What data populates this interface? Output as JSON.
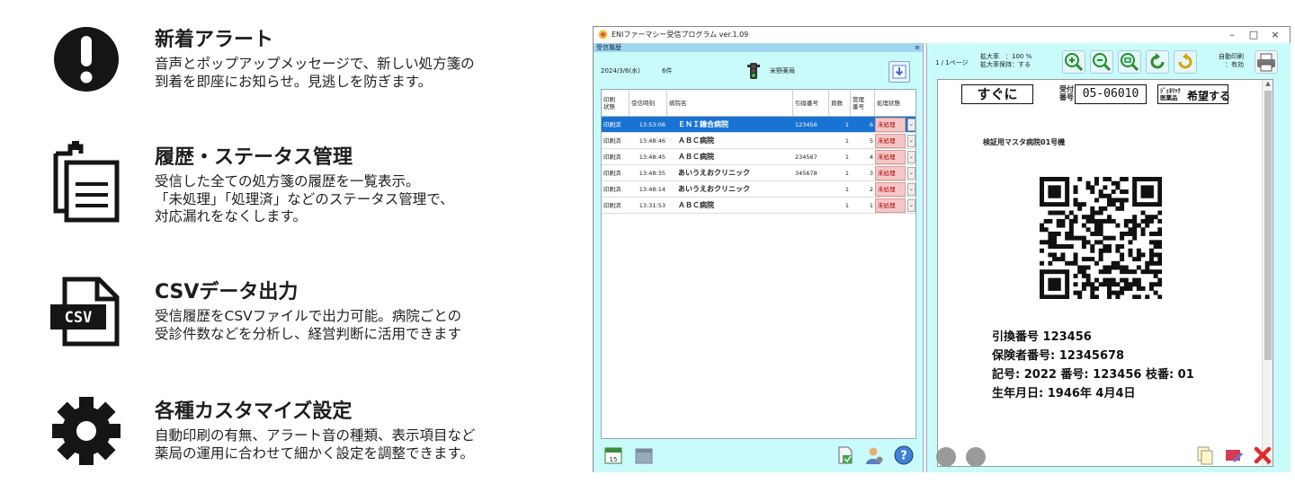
{
  "features": [
    {
      "icon": "alert-icon",
      "title": "新着アラート",
      "description": "音声とポップアップメッセージで、新しい処方箋の\n到着を即座にお知らせ。見逃しを防ぎます。"
    },
    {
      "icon": "clipboard-icon",
      "title": "履歴・ステータス管理",
      "description": "受信した全ての処方箋の履歴を一覧表示。\n「未処理」「処理済」などのステータス管理で、\n対応漏れをなくします。"
    },
    {
      "icon": "csv-file-icon",
      "title": "CSVデータ出力",
      "description": "受信履歴をCSVファイルで出力可能。病院ごとの\n受診件数などを分析し、経営判断に活用できます"
    },
    {
      "icon": "gear-icon",
      "title": "各種カスタマイズ設定",
      "description": "自動印刷の有無、アラート音の種類、表示項目など\n薬局の運用に合わせて細かく設定を調整できます。"
    }
  ],
  "csv_icon_label": "CSV",
  "window": {
    "title": "ENIファーマシー受信プログラム ver.1.09",
    "minimize": "–",
    "maximize": "□",
    "close": "×"
  },
  "left_pane": {
    "title": "受信履歴",
    "pin": "≡",
    "date": "2024/3/6(水)",
    "count": "6件",
    "pharmacy": "米野薬局",
    "columns": [
      "印刷\n状態",
      "受信時刻",
      "病院名",
      "引換番号",
      "頁数",
      "管理\n番号",
      "処理状態"
    ],
    "rows": [
      {
        "print": "印刷済",
        "time": "13:53:06",
        "hospital": "ＥＮＩ鐘合病院",
        "ticket": "123456",
        "pages": "1",
        "mgmt": "6",
        "status": "未処理",
        "selected": true
      },
      {
        "print": "印刷済",
        "time": "13:48:46",
        "hospital": "ＡＢＣ病院",
        "ticket": "",
        "pages": "1",
        "mgmt": "5",
        "status": "未処理",
        "selected": false
      },
      {
        "print": "印刷済",
        "time": "13:48:45",
        "hospital": "ＡＢＣ病院",
        "ticket": "234567",
        "pages": "1",
        "mgmt": "4",
        "status": "未処理",
        "selected": false
      },
      {
        "print": "印刷済",
        "time": "13:48:35",
        "hospital": "あいうえおクリニック",
        "ticket": "345678",
        "pages": "1",
        "mgmt": "3",
        "status": "未処理",
        "selected": false
      },
      {
        "print": "印刷済",
        "time": "13:48:14",
        "hospital": "あいうえおクリニック",
        "ticket": "",
        "pages": "1",
        "mgmt": "2",
        "status": "未処理",
        "selected": false
      },
      {
        "print": "印刷済",
        "time": "13:31:53",
        "hospital": "ＡＢＣ病院",
        "ticket": "",
        "pages": "1",
        "mgmt": "1",
        "status": "未処理",
        "selected": false
      }
    ],
    "calendar_label": "15"
  },
  "right_pane": {
    "page_info": "1 / 1ページ",
    "zoom_info": "拡大率　：100 %\n拡大率保持：する",
    "auto_print": "自動印刷\n：有効",
    "preview": {
      "sugu": "すぐに",
      "uketsuke_label": "受付\n番号",
      "uketsuke_no": "05-06010",
      "generic_label": "ｼﾞｪﾈﾘｯｸ\n医薬品",
      "generic_value": "希望する",
      "device": "検証用マスタ病院01号機",
      "lines": [
        "引換番号 123456",
        "保険者番号: 12345678",
        "記号: 2022 番号: 123456 枝番: 01",
        "生年月日: 1946年 4月4日"
      ]
    }
  },
  "colors": {
    "pane_bg": "#c9fbfb",
    "selected_row": "#1873d3",
    "status_bg": "#f6c6c6"
  }
}
